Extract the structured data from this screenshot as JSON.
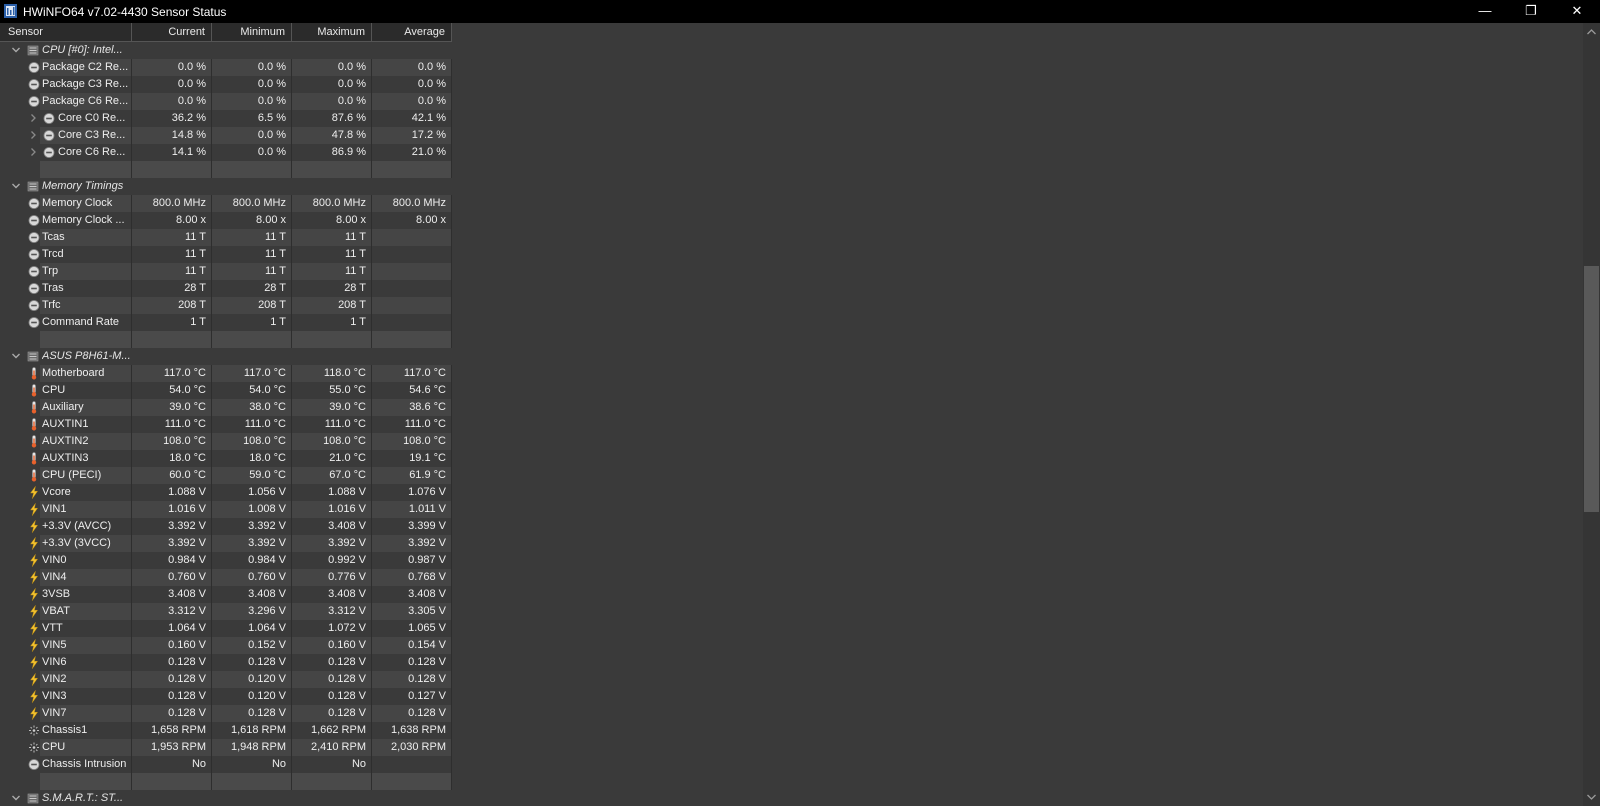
{
  "window": {
    "title": "HWiNFO64 v7.02-4430 Sensor Status",
    "min_glyph": "—",
    "max_glyph": "❐",
    "close_glyph": "✕"
  },
  "columns": {
    "sensor": "Sensor",
    "current": "Current",
    "minimum": "Minimum",
    "maximum": "Maximum",
    "average": "Average"
  },
  "rows": [
    {
      "kind": "group",
      "name": "CPU [#0]: Intel...",
      "expanded": true
    },
    {
      "kind": "item",
      "icon": "clock-icon",
      "name": "Package C2 Re...",
      "cur": "0.0 %",
      "min": "0.0 %",
      "max": "0.0 %",
      "avg": "0.0 %"
    },
    {
      "kind": "item",
      "icon": "clock-icon",
      "name": "Package C3 Re...",
      "cur": "0.0 %",
      "min": "0.0 %",
      "max": "0.0 %",
      "avg": "0.0 %"
    },
    {
      "kind": "item",
      "icon": "clock-icon",
      "name": "Package C6 Re...",
      "cur": "0.0 %",
      "min": "0.0 %",
      "max": "0.0 %",
      "avg": "0.0 %"
    },
    {
      "kind": "child",
      "icon": "clock-icon",
      "name": "Core C0 Re...",
      "cur": "36.2 %",
      "min": "6.5 %",
      "max": "87.6 %",
      "avg": "42.1 %"
    },
    {
      "kind": "child",
      "icon": "clock-icon",
      "name": "Core C3 Re...",
      "cur": "14.8 %",
      "min": "0.0 %",
      "max": "47.8 %",
      "avg": "17.2 %"
    },
    {
      "kind": "child",
      "icon": "clock-icon",
      "name": "Core C6 Re...",
      "cur": "14.1 %",
      "min": "0.0 %",
      "max": "86.9 %",
      "avg": "21.0 %"
    },
    {
      "kind": "spacer"
    },
    {
      "kind": "group",
      "name": "Memory Timings",
      "expanded": true
    },
    {
      "kind": "item",
      "icon": "clock-icon",
      "name": "Memory Clock",
      "cur": "800.0 MHz",
      "min": "800.0 MHz",
      "max": "800.0 MHz",
      "avg": "800.0 MHz"
    },
    {
      "kind": "item",
      "icon": "clock-icon",
      "name": "Memory Clock ...",
      "cur": "8.00 x",
      "min": "8.00 x",
      "max": "8.00 x",
      "avg": "8.00 x"
    },
    {
      "kind": "item",
      "icon": "clock-icon",
      "name": "Tcas",
      "cur": "11 T",
      "min": "11 T",
      "max": "11 T",
      "avg": ""
    },
    {
      "kind": "item",
      "icon": "clock-icon",
      "name": "Trcd",
      "cur": "11 T",
      "min": "11 T",
      "max": "11 T",
      "avg": ""
    },
    {
      "kind": "item",
      "icon": "clock-icon",
      "name": "Trp",
      "cur": "11 T",
      "min": "11 T",
      "max": "11 T",
      "avg": ""
    },
    {
      "kind": "item",
      "icon": "clock-icon",
      "name": "Tras",
      "cur": "28 T",
      "min": "28 T",
      "max": "28 T",
      "avg": ""
    },
    {
      "kind": "item",
      "icon": "clock-icon",
      "name": "Trfc",
      "cur": "208 T",
      "min": "208 T",
      "max": "208 T",
      "avg": ""
    },
    {
      "kind": "item",
      "icon": "clock-icon",
      "name": "Command Rate",
      "cur": "1 T",
      "min": "1 T",
      "max": "1 T",
      "avg": ""
    },
    {
      "kind": "spacer"
    },
    {
      "kind": "group",
      "name": "ASUS P8H61-M...",
      "expanded": true
    },
    {
      "kind": "item",
      "icon": "thermometer-icon",
      "name": "Motherboard",
      "cur": "117.0 °C",
      "min": "117.0 °C",
      "max": "118.0 °C",
      "avg": "117.0 °C"
    },
    {
      "kind": "item",
      "icon": "thermometer-icon",
      "name": "CPU",
      "cur": "54.0 °C",
      "min": "54.0 °C",
      "max": "55.0 °C",
      "avg": "54.6 °C"
    },
    {
      "kind": "item",
      "icon": "thermometer-icon",
      "name": "Auxiliary",
      "cur": "39.0 °C",
      "min": "38.0 °C",
      "max": "39.0 °C",
      "avg": "38.6 °C"
    },
    {
      "kind": "item",
      "icon": "thermometer-icon",
      "name": "AUXTIN1",
      "cur": "111.0 °C",
      "min": "111.0 °C",
      "max": "111.0 °C",
      "avg": "111.0 °C"
    },
    {
      "kind": "item",
      "icon": "thermometer-icon",
      "name": "AUXTIN2",
      "cur": "108.0 °C",
      "min": "108.0 °C",
      "max": "108.0 °C",
      "avg": "108.0 °C"
    },
    {
      "kind": "item",
      "icon": "thermometer-icon",
      "name": "AUXTIN3",
      "cur": "18.0 °C",
      "min": "18.0 °C",
      "max": "21.0 °C",
      "avg": "19.1 °C"
    },
    {
      "kind": "item",
      "icon": "thermometer-icon",
      "name": "CPU (PECI)",
      "cur": "60.0 °C",
      "min": "59.0 °C",
      "max": "67.0 °C",
      "avg": "61.9 °C"
    },
    {
      "kind": "item",
      "icon": "lightning-icon",
      "name": "Vcore",
      "cur": "1.088 V",
      "min": "1.056 V",
      "max": "1.088 V",
      "avg": "1.076 V"
    },
    {
      "kind": "item",
      "icon": "lightning-icon",
      "name": "VIN1",
      "cur": "1.016 V",
      "min": "1.008 V",
      "max": "1.016 V",
      "avg": "1.011 V"
    },
    {
      "kind": "item",
      "icon": "lightning-icon",
      "name": "+3.3V (AVCC)",
      "cur": "3.392 V",
      "min": "3.392 V",
      "max": "3.408 V",
      "avg": "3.399 V"
    },
    {
      "kind": "item",
      "icon": "lightning-icon",
      "name": "+3.3V (3VCC)",
      "cur": "3.392 V",
      "min": "3.392 V",
      "max": "3.392 V",
      "avg": "3.392 V"
    },
    {
      "kind": "item",
      "icon": "lightning-icon",
      "name": "VIN0",
      "cur": "0.984 V",
      "min": "0.984 V",
      "max": "0.992 V",
      "avg": "0.987 V"
    },
    {
      "kind": "item",
      "icon": "lightning-icon",
      "name": "VIN4",
      "cur": "0.760 V",
      "min": "0.760 V",
      "max": "0.776 V",
      "avg": "0.768 V"
    },
    {
      "kind": "item",
      "icon": "lightning-icon",
      "name": "3VSB",
      "cur": "3.408 V",
      "min": "3.408 V",
      "max": "3.408 V",
      "avg": "3.408 V"
    },
    {
      "kind": "item",
      "icon": "lightning-icon",
      "name": "VBAT",
      "cur": "3.312 V",
      "min": "3.296 V",
      "max": "3.312 V",
      "avg": "3.305 V"
    },
    {
      "kind": "item",
      "icon": "lightning-icon",
      "name": "VTT",
      "cur": "1.064 V",
      "min": "1.064 V",
      "max": "1.072 V",
      "avg": "1.065 V"
    },
    {
      "kind": "item",
      "icon": "lightning-icon",
      "name": "VIN5",
      "cur": "0.160 V",
      "min": "0.152 V",
      "max": "0.160 V",
      "avg": "0.154 V"
    },
    {
      "kind": "item",
      "icon": "lightning-icon",
      "name": "VIN6",
      "cur": "0.128 V",
      "min": "0.128 V",
      "max": "0.128 V",
      "avg": "0.128 V"
    },
    {
      "kind": "item",
      "icon": "lightning-icon",
      "name": "VIN2",
      "cur": "0.128 V",
      "min": "0.120 V",
      "max": "0.128 V",
      "avg": "0.128 V"
    },
    {
      "kind": "item",
      "icon": "lightning-icon",
      "name": "VIN3",
      "cur": "0.128 V",
      "min": "0.120 V",
      "max": "0.128 V",
      "avg": "0.127 V"
    },
    {
      "kind": "item",
      "icon": "lightning-icon",
      "name": "VIN7",
      "cur": "0.128 V",
      "min": "0.128 V",
      "max": "0.128 V",
      "avg": "0.128 V"
    },
    {
      "kind": "item",
      "icon": "fan-icon",
      "name": "Chassis1",
      "cur": "1,658 RPM",
      "min": "1,618 RPM",
      "max": "1,662 RPM",
      "avg": "1,638 RPM"
    },
    {
      "kind": "item",
      "icon": "fan-icon",
      "name": "CPU",
      "cur": "1,953 RPM",
      "min": "1,948 RPM",
      "max": "2,410 RPM",
      "avg": "2,030 RPM"
    },
    {
      "kind": "item",
      "icon": "clock-icon",
      "name": "Chassis Intrusion",
      "cur": "No",
      "min": "No",
      "max": "No",
      "avg": ""
    },
    {
      "kind": "spacer"
    },
    {
      "kind": "group",
      "name": "S.M.A.R.T.: ST...",
      "expanded": true
    }
  ]
}
